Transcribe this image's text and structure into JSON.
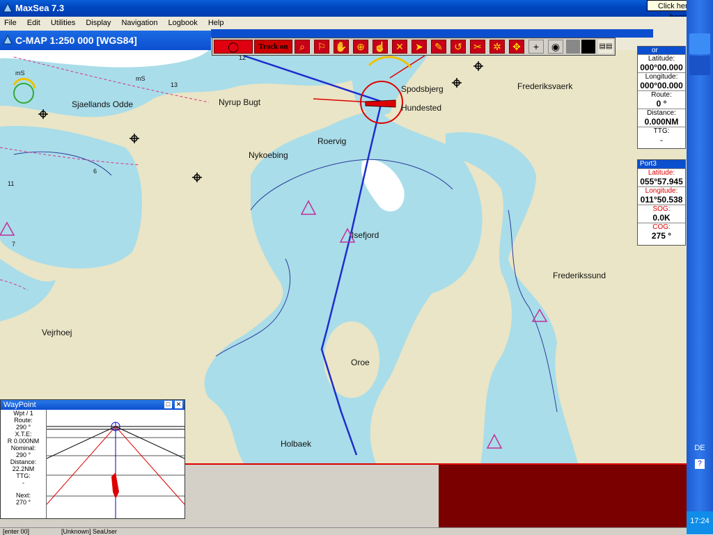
{
  "app": {
    "title": "MaxSea 7.3",
    "tooltip": "Click here to begin"
  },
  "menu": [
    "File",
    "Edit",
    "Utilities",
    "Display",
    "Navigation",
    "Logbook",
    "Help"
  ],
  "chart_window": {
    "title": "C-MAP  1:250 000 [WGS84]"
  },
  "toolbar": {
    "track_label": "Track on"
  },
  "places": [
    "Sjaellands Odde",
    "Nyrup Bugt",
    "Spodsbjerg",
    "Hundested",
    "Frederiksvaerk",
    "Roervig",
    "Nykoebing",
    "Isefjord",
    "Frederikssund",
    "Vejrhoej",
    "Oroe",
    "Holbaek",
    "mS"
  ],
  "soundings": [
    "12",
    "13",
    "6",
    "11",
    "7",
    "mS"
  ],
  "nav_panel": {
    "header": "or",
    "latitude_label": "Latitude:",
    "latitude": "000°00.000",
    "longitude_label": "Longitude:",
    "longitude": "000°00.000",
    "route_label": "Route:",
    "route": "0 °",
    "distance_label": "Distance:",
    "distance": "0.000NM",
    "ttg_label": "TTG:",
    "ttg": "-"
  },
  "port_panel": {
    "header": "Port3",
    "latitude_label": "Latitude:",
    "latitude": "055°57.945",
    "longitude_label": "Longitude:",
    "longitude": "011°50.538",
    "sog_label": "SOG:",
    "sog": "0.0K",
    "cog_label": "COG:",
    "cog": "275 °"
  },
  "waypoint": {
    "title": "WayPoint",
    "wpt": "Wpt / 1",
    "route_label": "Route:",
    "route": "290 °",
    "xte_label": "X.T.E:",
    "xte": "R 0.000NM",
    "nominal_label": "Nominal:",
    "nominal": "290 °",
    "distance_label": "Distance:",
    "distance": "22.2NM",
    "ttg_label": "TTG:",
    "ttg": "-",
    "next_label": "Next:",
    "next": "270 °"
  },
  "status": {
    "left": "[enter 00]",
    "user": "[Unknown] SeaUser"
  },
  "taskbar": {
    "lang": "DE",
    "clock": "17:24"
  },
  "colors": {
    "water": "#a9dde9",
    "land": "#eae5c6",
    "track": "#1d2ccc",
    "alert": "#d00000"
  }
}
